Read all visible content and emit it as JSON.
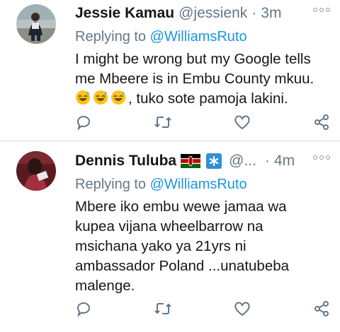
{
  "tweets": [
    {
      "name": "Jessie Kamau",
      "handle": "@jessienk",
      "separator": "·",
      "time": "3m",
      "replying_prefix": "Replying to",
      "replying_to": "@WilliamsRuto",
      "text_lines": [
        "I might be wrong but my Google tells",
        "me Mbeere is in Embu County mkuu."
      ],
      "text_after_emoji": ", tuko sote pamoja lakini.",
      "emoji_count": 3,
      "emoji": "sweat-smile-emoji"
    },
    {
      "name": "Dennis Tuluba",
      "handle": "@...",
      "separator": "·",
      "time": "4m",
      "replying_prefix": "Replying to",
      "replying_to": "@WilliamsRuto",
      "text_lines": [
        "Mbere iko embu wewe jamaa wa",
        "kupea vijana wheelbarrow na",
        "msichana yako ya 21yrs ni",
        "ambassador Poland ...unatubeba",
        "malenge."
      ],
      "name_badges": [
        "kenya-flag-icon",
        "blue-asterisk-badge-icon"
      ]
    }
  ],
  "action_icons": [
    "reply-icon",
    "retweet-icon",
    "like-icon",
    "share-icon"
  ],
  "colors": {
    "link": "#1b95e0",
    "secondary": "#657786",
    "text": "#14171a",
    "divider": "#d4d9dd"
  }
}
